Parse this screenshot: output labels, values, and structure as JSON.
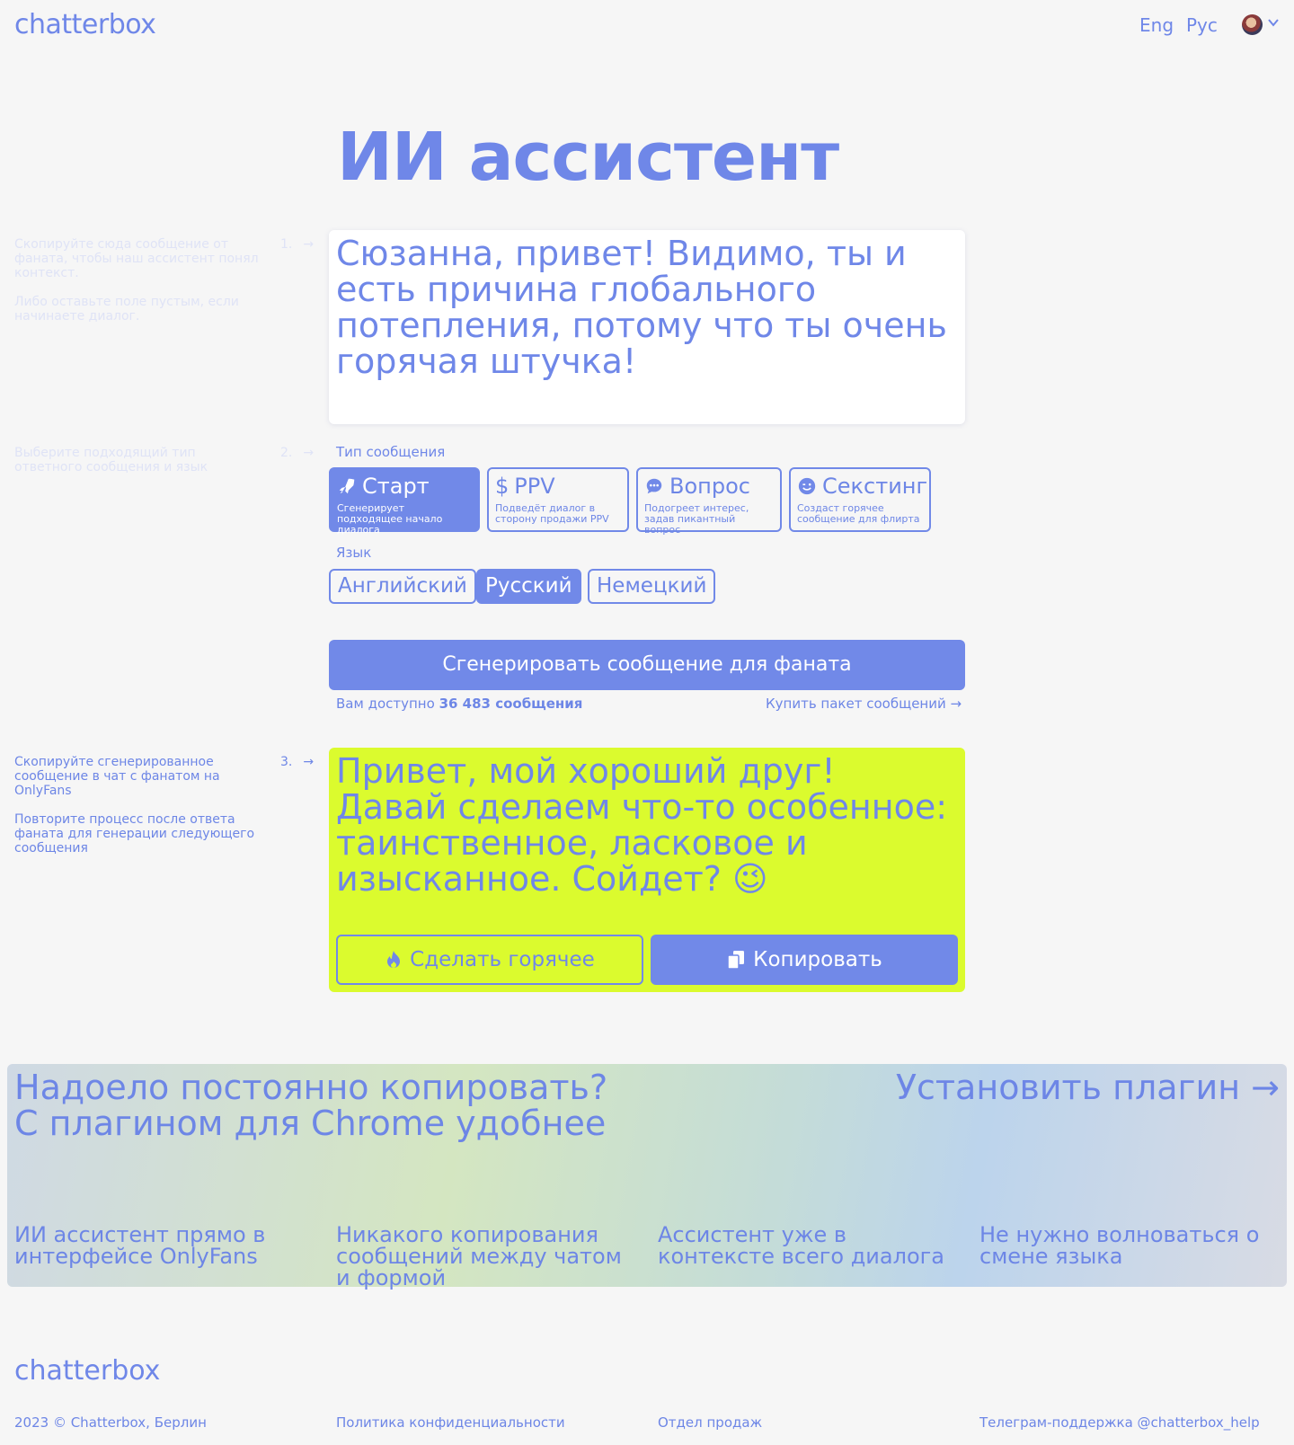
{
  "header": {
    "logo": "chatterbox",
    "lang_en": "Eng",
    "lang_ru": "Рус"
  },
  "page_title": "ИИ ассистент",
  "step1": {
    "number": "1.",
    "arrow": "→",
    "hint_1": "Скопируйте сюда сообщение от фаната, чтобы наш ассистент понял контекст.",
    "hint_2": "Либо оставьте поле пустым, если начинаете диалог.",
    "input_value": "Сюзанна, привет! Видимо, ты и есть причина глобального потепления, потому что ты очень горячая штучка!"
  },
  "step2": {
    "number": "2.",
    "arrow": "→",
    "hint": "Выберите подходящий тип ответного сообщения и язык",
    "type_label": "Тип сообщения",
    "types": [
      {
        "title": "Старт",
        "desc": "Сгенерирует подходящее начало диалога",
        "icon": "rocket-icon",
        "selected": true
      },
      {
        "title": "PPV",
        "desc": "Подведёт диалог в сторону продажи PPV",
        "icon": "dollar-icon",
        "selected": false
      },
      {
        "title": "Вопрос",
        "desc": "Подогреет интерес, задав пикантный вопрос",
        "icon": "chat-bubble-icon",
        "selected": false
      },
      {
        "title": "Секстинг",
        "desc": "Создаст горячее сообщение для флирта",
        "icon": "wink-face-icon",
        "selected": false
      }
    ],
    "lang_label": "Язык",
    "languages": [
      {
        "label": "Английский",
        "selected": false
      },
      {
        "label": "Русский",
        "selected": true
      },
      {
        "label": "Немецкий",
        "selected": false
      }
    ]
  },
  "generate": {
    "button": "Сгенерировать сообщение для фаната",
    "available_prefix": "Вам доступно",
    "available_count": "36 483 сообщения",
    "buy_link": "Купить пакет сообщений →"
  },
  "step3": {
    "number": "3.",
    "arrow": "→",
    "hint_1": "Скопируйте сгенерированное сообщение в чат с фанатом на OnlyFans",
    "hint_2": "Повторите процесс после ответа фаната для генерации следующего сообщения",
    "result": "Привет, мой хороший друг! Давай сделаем что-то особенное: таинственное, ласковое и изысканное. Сойдет?",
    "result_emoji": "😉",
    "hot_button": "Сделать горячее",
    "copy_button": "Копировать"
  },
  "promo": {
    "heading_1": "Надоело постоянно копировать?",
    "heading_2": "С плагином для Chrome удобнее",
    "install": "Установить плагин →",
    "features": [
      "ИИ ассистент прямо в интерфейсе OnlyFans",
      "Никакого копирования сообщений между чатом и формой",
      "Ассистент уже в контексте всего диалога",
      "Не нужно волноваться о смене языка"
    ]
  },
  "footer": {
    "logo": "chatterbox",
    "copyright": "2023 © Chatterbox, Берлин",
    "privacy": "Политика конфиденциальности",
    "sales": "Отдел продаж",
    "support": "Телеграм-поддержка @chatterbox_help"
  },
  "colors": {
    "accent": "#7189e8",
    "result_bg": "#dbfb2e",
    "page_bg": "#f6f6f6"
  }
}
